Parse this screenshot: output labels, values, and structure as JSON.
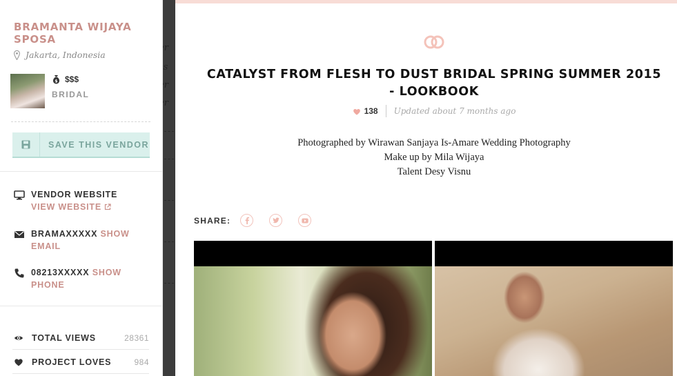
{
  "vendor": {
    "name": "BRAMANTA WIJAYA SPOSA",
    "location": "Jakarta, Indonesia",
    "price": "$$$",
    "category": "BRIDAL",
    "save_label": "SAVE THIS VENDOR"
  },
  "contacts": {
    "website_title": "VENDOR WEBSITE",
    "website_link": "VIEW WEBSITE",
    "email_masked": "BRAMAXXXXX",
    "email_link_1": "SHOW",
    "email_link_2": "EMAIL",
    "phone_masked": "08213XXXXX",
    "phone_link_1": "SHOW",
    "phone_link_2": "PHONE"
  },
  "stats": {
    "views_label": "TOTAL VIEWS",
    "views_value": "28361",
    "loves_label": "PROJECT LOVES",
    "loves_value": "984"
  },
  "project": {
    "title": "CATALYST FROM FLESH TO DUST BRIDAL SPRING SUMMER 2015 - LOOKBOOK",
    "loves": "138",
    "updated": "Updated about 7 months ago",
    "credit_1": "Photographed by Wirawan Sanjaya Is-Amare Wedding Photography",
    "credit_2": "Make up by Mila Wijaya",
    "credit_3": "Talent Desy Visnu",
    "share_label": "SHARE:"
  },
  "colors": {
    "accent": "#c9908a",
    "save_bg": "#daf0ec",
    "top_bar": "#f8dcd6"
  },
  "icons": [
    "map-pin-icon",
    "money-bag-icon",
    "floppy-disk-icon",
    "monitor-icon",
    "external-link-icon",
    "envelope-icon",
    "phone-icon",
    "eye-icon",
    "heart-icon",
    "wedding-rings-icon",
    "facebook-icon",
    "twitter-icon",
    "youtube-icon"
  ]
}
